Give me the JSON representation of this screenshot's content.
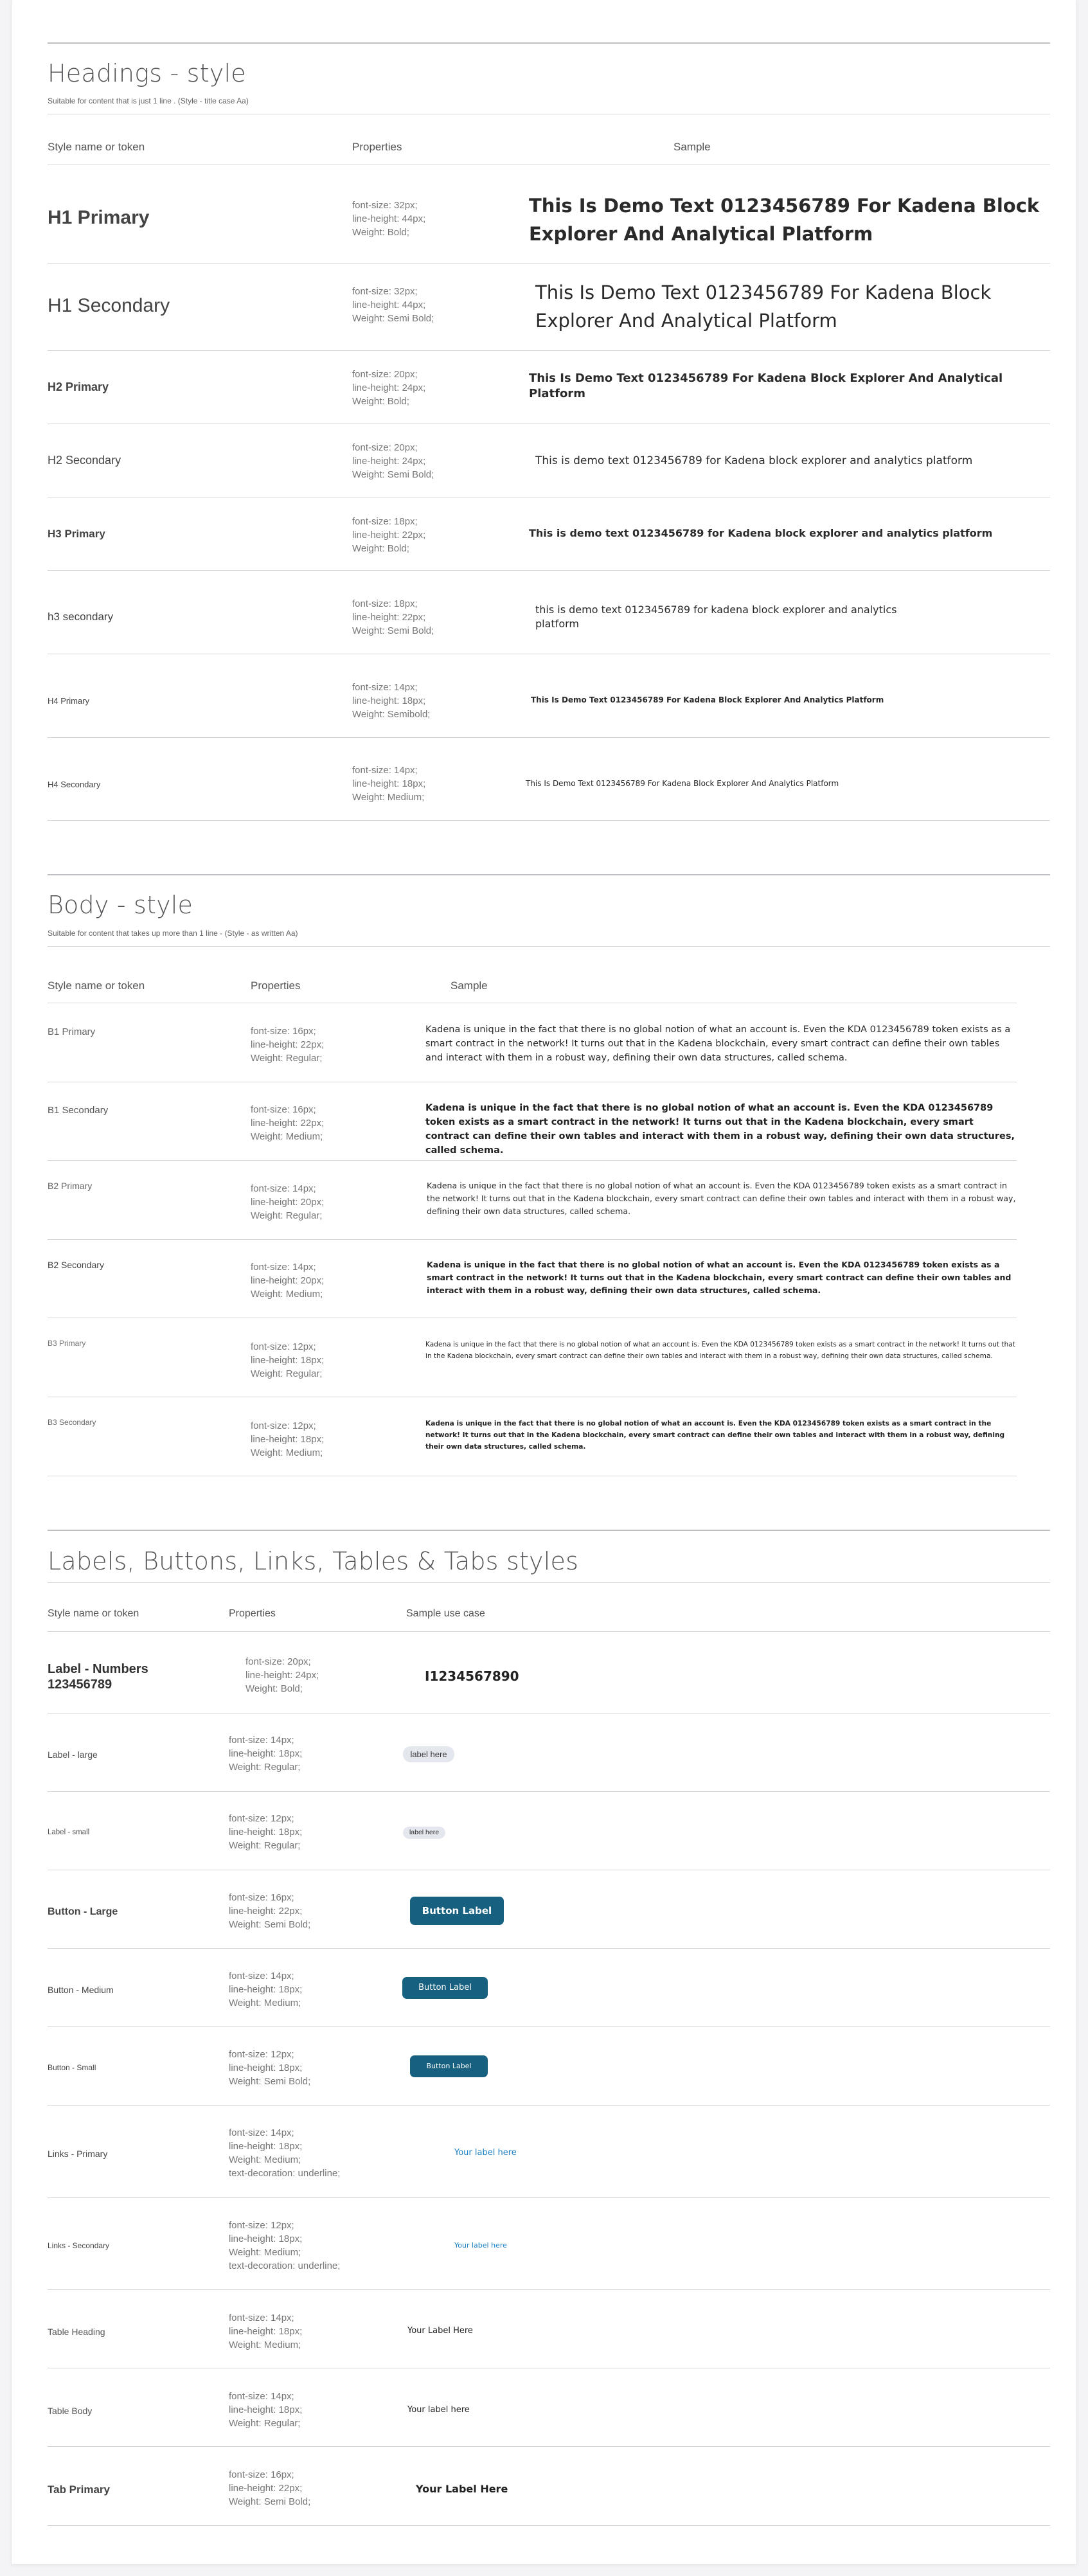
{
  "headings": {
    "title": "Headings - style",
    "subtitle": "Suitable for content that is just 1 line . (Style - title case Aa)",
    "col_name": "Style name or token",
    "col_props": "Properties",
    "col_sample": "Sample",
    "rows": [
      {
        "name": "H1 Primary",
        "props": "font-size: 32px;\nline-height: 44px;\nWeight: Bold;",
        "sample": "This Is Demo Text 0123456789 For Kadena Block Explorer And Analytical Platform"
      },
      {
        "name": "H1 Secondary",
        "props": "font-size: 32px;\nline-height: 44px;\nWeight: Semi Bold;",
        "sample": "This Is Demo Text 0123456789 For Kadena Block Explorer And Analytical Platform"
      },
      {
        "name": "H2 Primary",
        "props": "font-size: 20px;\nline-height: 24px;\nWeight: Bold;",
        "sample": "This Is Demo Text 0123456789 For Kadena Block Explorer And Analytical Platform"
      },
      {
        "name": "H2 Secondary",
        "props": "font-size: 20px;\nline-height: 24px;\nWeight: Semi Bold;",
        "sample": "This is demo text 0123456789 for Kadena block explorer and analytics platform"
      },
      {
        "name": "H3 Primary",
        "props": "font-size: 18px;\nline-height: 22px;\nWeight: Bold;",
        "sample": "This is demo text 0123456789 for Kadena block explorer and analytics platform"
      },
      {
        "name": "h3  secondary",
        "props": "font-size: 18px;\nline-height: 22px;\nWeight: Semi Bold;",
        "sample": "this is demo text 0123456789 for kadena block explorer and analytics platform"
      },
      {
        "name": "H4 Primary",
        "props": "font-size: 14px;\nline-height: 18px;\nWeight: Semibold;",
        "sample": "This Is Demo Text 0123456789 For Kadena Block Explorer And Analytics Platform"
      },
      {
        "name": "H4  Secondary",
        "props": "font-size: 14px;\nline-height: 18px;\nWeight: Medium;",
        "sample": "This Is Demo Text 0123456789 For Kadena Block Explorer And Analytics Platform"
      }
    ]
  },
  "body": {
    "title": "Body - style",
    "subtitle": "Suitable for content that takes up more than 1 line - (Style - as written Aa)",
    "col_name": "Style name or token",
    "col_props": "Properties",
    "col_sample": "Sample",
    "sample_text": "Kadena is unique in the fact that there is no global notion of what an account is. Even the KDA 0123456789 token exists as a smart contract in the network! It turns out that in the Kadena blockchain, every smart contract can define their own tables and interact with them in a robust way, defining their own data structures, called schema.",
    "rows": [
      {
        "name": "B1 Primary",
        "props": "font-size: 16px;\nline-height: 22px;\nWeight: Regular;"
      },
      {
        "name": "B1 Secondary",
        "props": "font-size: 16px;\nline-height: 22px;\nWeight: Medium;"
      },
      {
        "name": "B2 Primary",
        "props": "font-size: 14px;\nline-height: 20px;\nWeight: Regular;"
      },
      {
        "name": "B2 Secondary",
        "props": "font-size: 14px;\nline-height: 20px;\nWeight: Medium;"
      },
      {
        "name": "B3 Primary",
        "props": "font-size: 12px;\nline-height: 18px;\nWeight: Regular;"
      },
      {
        "name": "B3 Secondary",
        "props": "font-size: 12px;\nline-height: 18px;\nWeight: Medium;"
      }
    ]
  },
  "labels": {
    "title": "Labels, Buttons, Links, Tables & Tabs styles",
    "col_name": "Style name or token",
    "col_props": "Properties",
    "col_sample": "Sample use case",
    "rows": [
      {
        "name": "Label - Numbers\n123456789",
        "props": "font-size: 20px;\nline-height: 24px;\nWeight: Bold;",
        "sample": "I1234567890"
      },
      {
        "name": "Label - large",
        "props": "font-size: 14px;\nline-height: 18px;\nWeight: Regular;",
        "sample": "label here"
      },
      {
        "name": "Label - small",
        "props": "font-size: 12px;\nline-height: 18px;\nWeight: Regular;",
        "sample": "label here"
      },
      {
        "name": "Button - Large",
        "props": "font-size: 16px;\nline-height: 22px;\nWeight: Semi Bold;",
        "sample": "Button Label"
      },
      {
        "name": "Button - Medium",
        "props": "font-size: 14px;\nline-height: 18px;\nWeight: Medium;",
        "sample": "Button Label"
      },
      {
        "name": "Button - Small",
        "props": "font-size: 12px;\nline-height: 18px;\nWeight: Semi Bold;",
        "sample": "Button Label"
      },
      {
        "name": "Links - Primary",
        "props": "font-size: 14px;\nline-height: 18px;\nWeight: Medium;\ntext-decoration: underline;",
        "sample": "Your label here"
      },
      {
        "name": "Links - Secondary",
        "props": "font-size: 12px;\nline-height: 18px;\nWeight: Medium;\ntext-decoration: underline;",
        "sample": "Your label here"
      },
      {
        "name": "Table Heading",
        "props": "font-size: 14px;\nline-height: 18px;\nWeight: Medium;",
        "sample": "Your Label Here"
      },
      {
        "name": "Table Body",
        "props": "font-size: 14px;\nline-height: 18px;\nWeight: Regular;",
        "sample": "Your label here"
      },
      {
        "name": "Tab Primary",
        "props": "font-size: 16px;\nline-height: 22px;\nWeight: Semi Bold;",
        "sample": "Your Label Here"
      }
    ]
  },
  "colors": {
    "button_bg": "#17607f",
    "link": "#1a7fc2",
    "pill_bg": "#e4e7ee"
  }
}
